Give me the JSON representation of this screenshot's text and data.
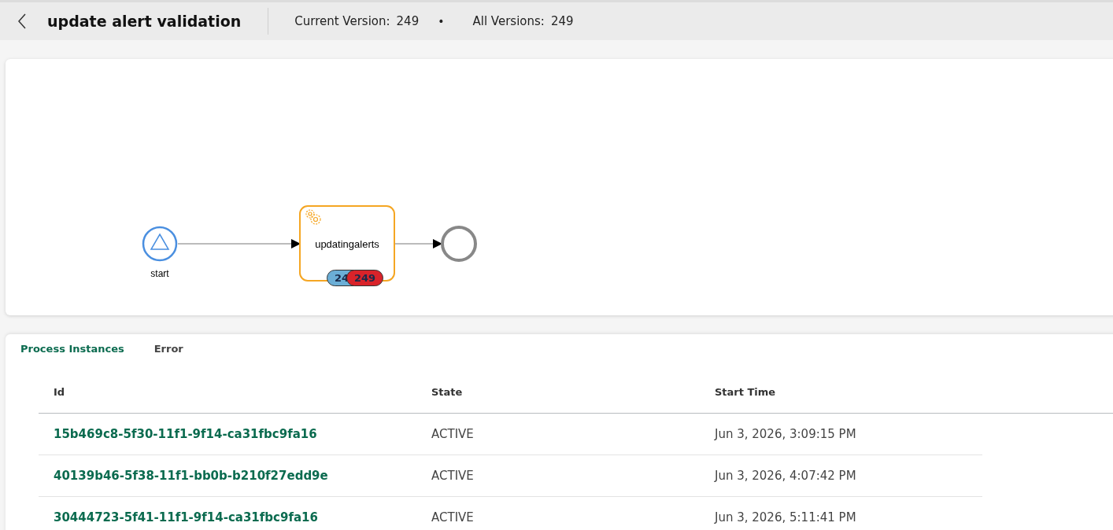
{
  "header": {
    "title": "update alert validation",
    "current_version_label": "Current Version:",
    "current_version": "249",
    "separator": "•",
    "all_versions_label": "All Versions:",
    "all_versions": "249"
  },
  "diagram": {
    "start": {
      "label": "start"
    },
    "task": {
      "label": "updatingalerts",
      "badges": [
        {
          "text": "24",
          "color": "#6baed6"
        },
        {
          "text": "249",
          "color": "#d9232a"
        }
      ]
    }
  },
  "tabs": [
    {
      "label": "Process Instances",
      "selected": true
    },
    {
      "label": "Error",
      "selected": false
    }
  ],
  "table": {
    "columns": [
      "Id",
      "State",
      "Start Time"
    ],
    "rows": [
      {
        "id": "15b469c8-5f30-11f1-9f14-ca31fbc9fa16",
        "state": "ACTIVE",
        "start_time": "Jun 3, 2026, 3:09:15 PM"
      },
      {
        "id": "40139b46-5f38-11f1-bb0b-b210f27edd9e",
        "state": "ACTIVE",
        "start_time": "Jun 3, 2026, 4:07:42 PM"
      },
      {
        "id": "30444723-5f41-11f1-9f14-ca31fbc9fa16",
        "state": "ACTIVE",
        "start_time": "Jun 3, 2026, 5:11:41 PM"
      }
    ]
  }
}
